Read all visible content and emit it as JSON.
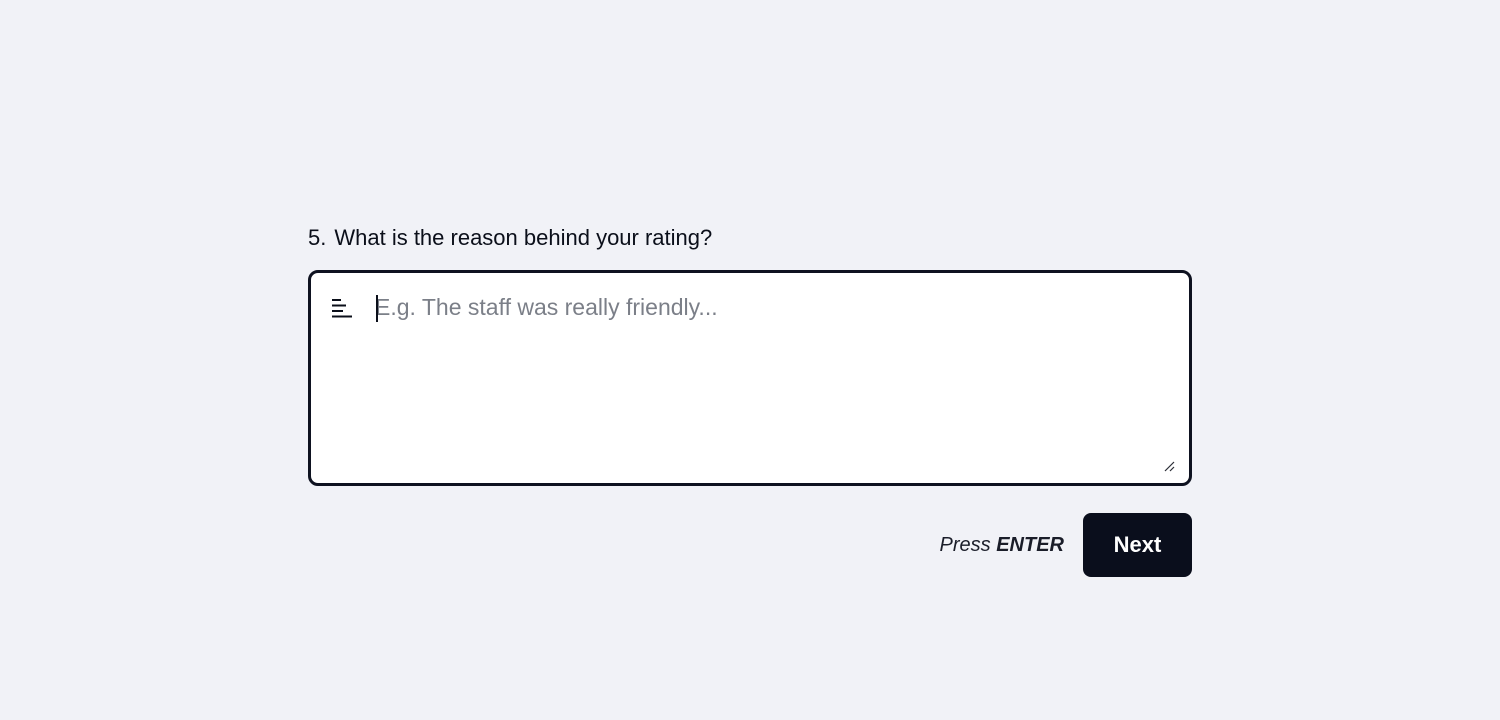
{
  "question": {
    "number": "5.",
    "title": "What is the reason behind your rating?"
  },
  "answer": {
    "icon": "text-lines-icon",
    "value": "",
    "placeholder": "E.g. The staff was really friendly..."
  },
  "footer": {
    "hint_prefix": "Press",
    "hint_key": "ENTER",
    "next_label": "Next"
  },
  "colors": {
    "background": "#f1f2f7",
    "border": "#0e1220",
    "button": "#0a0e1c",
    "placeholder": "#7b7f88"
  }
}
